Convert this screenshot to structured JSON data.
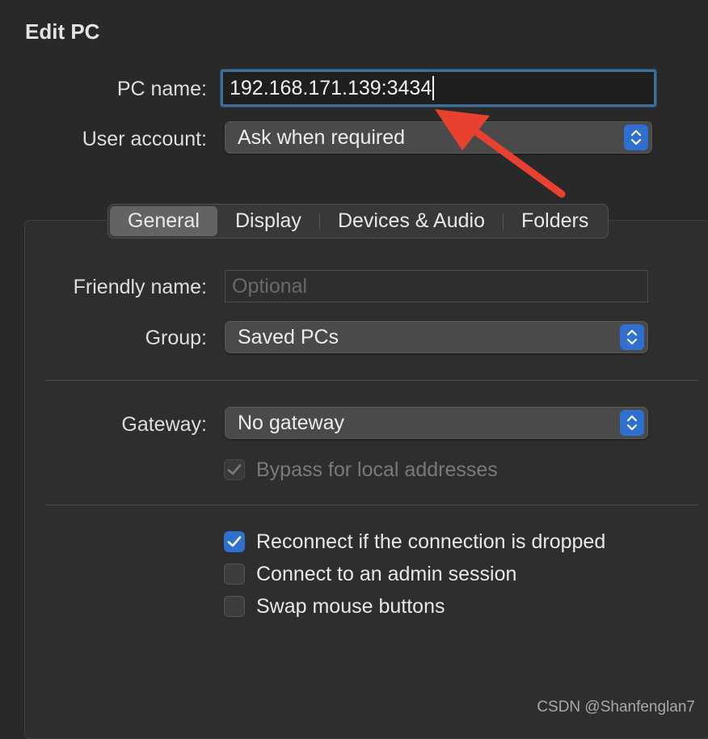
{
  "window": {
    "title": "Edit PC"
  },
  "top_form": {
    "pc_name_label": "PC name:",
    "pc_name_value": "192.168.171.139:3434",
    "user_account_label": "User account:",
    "user_account_value": "Ask when required"
  },
  "tabs": [
    {
      "label": "General",
      "active": true
    },
    {
      "label": "Display",
      "active": false
    },
    {
      "label": "Devices & Audio",
      "active": false
    },
    {
      "label": "Folders",
      "active": false
    }
  ],
  "general": {
    "friendly_name_label": "Friendly name:",
    "friendly_name_placeholder": "Optional",
    "group_label": "Group:",
    "group_value": "Saved PCs",
    "gateway_label": "Gateway:",
    "gateway_value": "No gateway",
    "options": {
      "bypass": {
        "label": "Bypass for local addresses",
        "checked": true,
        "disabled": true
      },
      "reconnect": {
        "label": "Reconnect if the connection is dropped",
        "checked": true,
        "disabled": false
      },
      "admin": {
        "label": "Connect to an admin session",
        "checked": false,
        "disabled": false
      },
      "swap": {
        "label": "Swap mouse buttons",
        "checked": false,
        "disabled": false
      }
    }
  },
  "colors": {
    "accent": "#2f6fd0",
    "annotation_arrow": "#e8412f",
    "focus_ring": "#3d6f98"
  },
  "watermark": "CSDN @Shanfenglan7"
}
